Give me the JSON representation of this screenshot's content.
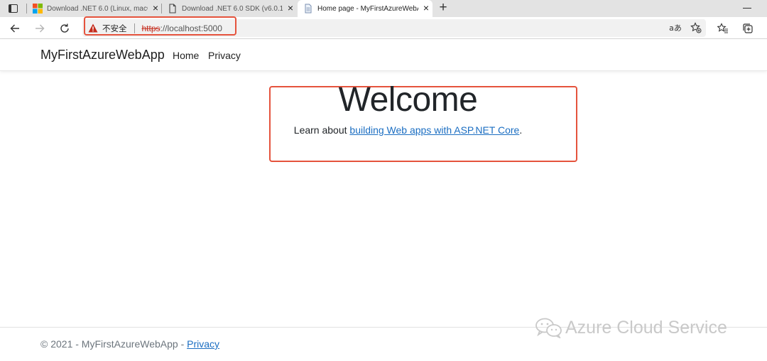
{
  "browser": {
    "tabs": [
      {
        "title": "Download .NET 6.0 (Linux, macO",
        "icon": "microsoft-logo-icon",
        "active": false
      },
      {
        "title": "Download .NET 6.0 SDK (v6.0.10",
        "icon": "document-icon",
        "active": false
      },
      {
        "title": "Home page - MyFirstAzureWebA",
        "icon": "page-icon",
        "active": true
      }
    ],
    "address": {
      "security_label": "不安全",
      "url_scheme": "https",
      "url_rest": "://localhost:5000"
    },
    "toolbar_icons": [
      "back-arrow-icon",
      "forward-arrow-icon",
      "refresh-icon",
      "read-aloud-icon",
      "add-favorite-icon",
      "favorites-icon",
      "collections-icon"
    ]
  },
  "app": {
    "brand": "MyFirstAzureWebApp",
    "nav": {
      "home": "Home",
      "privacy": "Privacy"
    },
    "main": {
      "heading": "Welcome",
      "learn_prefix": "Learn about ",
      "learn_link": "building Web apps with ASP.NET Core",
      "learn_suffix": "."
    },
    "footer": {
      "text": "© 2021 - MyFirstAzureWebApp - ",
      "link": "Privacy"
    }
  },
  "watermark": {
    "text": "Azure Cloud Service"
  },
  "colors": {
    "highlight": "#e5533d",
    "link": "#1b6ec2",
    "insecure": "#c42b1c"
  }
}
